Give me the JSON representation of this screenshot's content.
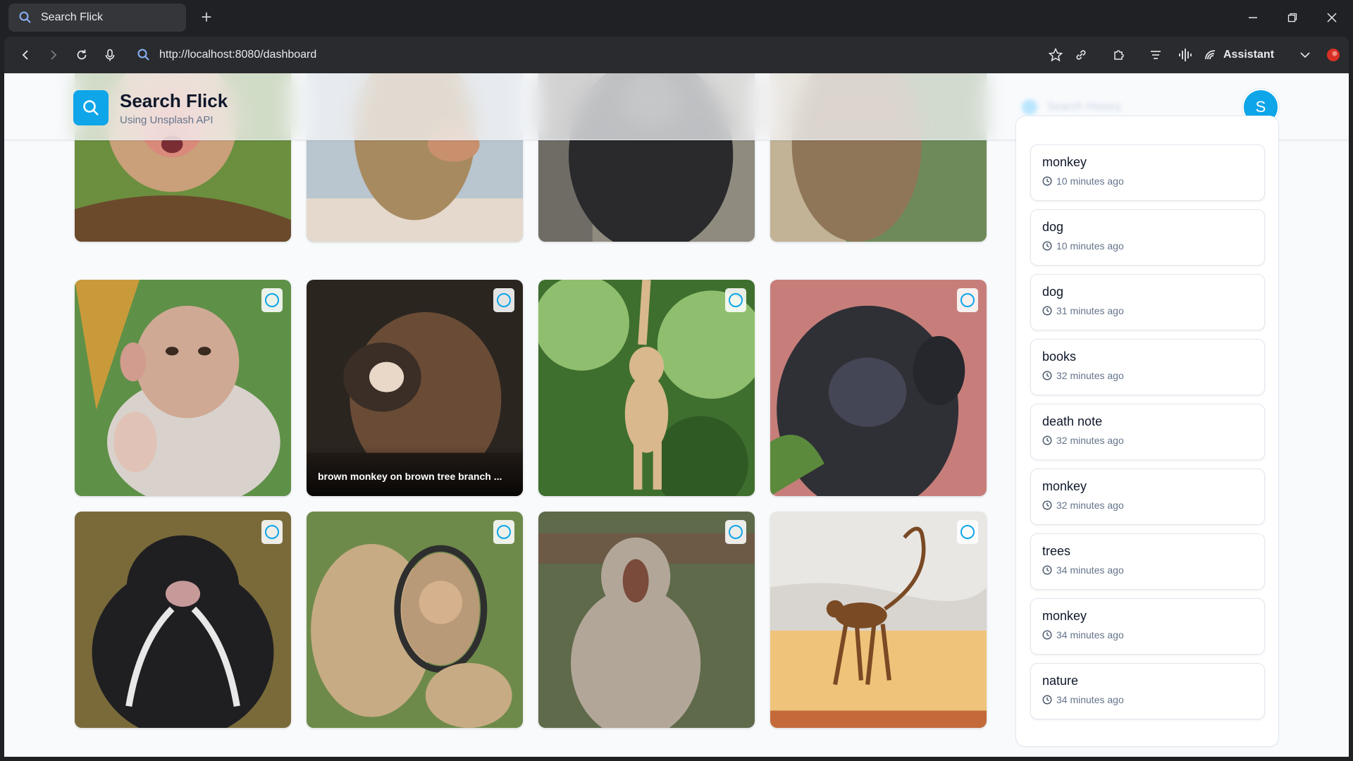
{
  "browser": {
    "tab_title": "Search Flick",
    "new_tab": "+",
    "url": "http://localhost:8080/dashboard",
    "assistant_label": "Assistant"
  },
  "app": {
    "title": "Search Flick",
    "subtitle": "Using Unsplash API",
    "search_placeholder": "Search History",
    "avatar_initial": "S"
  },
  "photos": [
    {
      "subject": "macaque-baby-red-face",
      "caption": "",
      "palette": [
        "#6b8f3e",
        "#c9a07a",
        "#d98a7a"
      ]
    },
    {
      "subject": "monkey-sitting-water",
      "caption": "",
      "palette": [
        "#b9c5cf",
        "#a88a60",
        "#e4d9cc"
      ]
    },
    {
      "subject": "gorilla-dark",
      "caption": "",
      "palette": [
        "#8f8b7f",
        "#2a2a2c",
        "#6f6c66"
      ]
    },
    {
      "subject": "monkey-hidden-face",
      "caption": "",
      "palette": [
        "#6f8a5a",
        "#8f7658",
        "#c2b296"
      ]
    },
    {
      "subject": "bonnet-macaque-waving",
      "caption": "",
      "palette": [
        "#5f9048",
        "#cfa994",
        "#d9d2cc"
      ]
    },
    {
      "subject": "brown-monkey-yawning",
      "caption": "brown monkey on brown tree branch ...",
      "palette": [
        "#2b2520",
        "#6a4c36",
        "#3a2e26"
      ]
    },
    {
      "subject": "gibbon-hanging-tree",
      "caption": "",
      "palette": [
        "#3f6f2f",
        "#d8b88c",
        "#8fbf6e"
      ]
    },
    {
      "subject": "gorilla-thinking",
      "caption": "",
      "palette": [
        "#c77e7a",
        "#2f3036",
        "#5c8a3c"
      ]
    },
    {
      "subject": "emperor-tamarin",
      "caption": "",
      "palette": [
        "#7a6a3a",
        "#1f1f22",
        "#e8e8e8"
      ]
    },
    {
      "subject": "monkey-mirror",
      "caption": "",
      "palette": [
        "#6e8a4a",
        "#c7ab84",
        "#2e2e2e"
      ]
    },
    {
      "subject": "macaque-yawning",
      "caption": "",
      "palette": [
        "#5e6a4a",
        "#b2a698",
        "#7a4a3a"
      ]
    },
    {
      "subject": "langur-walking-sunset",
      "caption": "",
      "palette": [
        "#e9e7e3",
        "#f0c37a",
        "#7a4a24"
      ]
    }
  ],
  "history": [
    {
      "term": "monkey",
      "time": "10 minutes ago"
    },
    {
      "term": "dog",
      "time": "10 minutes ago"
    },
    {
      "term": "dog",
      "time": "31 minutes ago"
    },
    {
      "term": "books",
      "time": "32 minutes ago"
    },
    {
      "term": "death note",
      "time": "32 minutes ago"
    },
    {
      "term": "monkey",
      "time": "32 minutes ago"
    },
    {
      "term": "trees",
      "time": "34 minutes ago"
    },
    {
      "term": "monkey",
      "time": "34 minutes ago"
    },
    {
      "term": "nature",
      "time": "34 minutes ago"
    }
  ],
  "colors": {
    "accent": "#0ea5e9",
    "page_bg": "#f8fafc",
    "chrome_bg": "#202124"
  }
}
